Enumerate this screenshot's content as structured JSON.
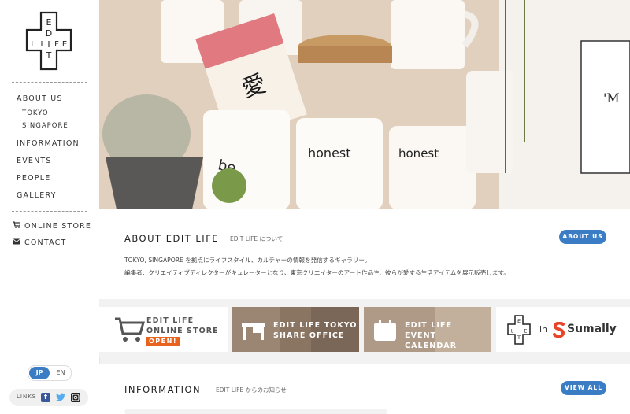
{
  "logo": {
    "letters": [
      "E",
      "D",
      "I",
      "T",
      "L",
      "I",
      "F",
      "E"
    ]
  },
  "nav": {
    "about": "ABOUT US",
    "tokyo": "TOKYO",
    "singapore": "SINGAPORE",
    "information": "INFORMATION",
    "events": "EVENTS",
    "people": "PEOPLE",
    "gallery": "GALLERY",
    "online_store": "ONLINE STORE",
    "contact": "CONTACT"
  },
  "lang": {
    "jp": "JP",
    "en": "EN"
  },
  "links": {
    "label": "LINKS"
  },
  "hero": {
    "partial_text": "'M"
  },
  "about": {
    "title": "ABOUT EDIT LIFE",
    "subtitle": "EDIT LIFE について",
    "button": "ABOUT US",
    "line1": "TOKYO, SINGAPORE を拠点にライフスタイル、カルチャーの情報を発信するギャラリー。",
    "line2": "編集者、クリエイティブディレクターがキュレーターとなり、東京クリエイターのアート作品や、彼らが愛する生活アイテムを展示販売します。"
  },
  "banners": {
    "store_line1": "EDIT LIFE",
    "store_line2": "ONLINE STORE",
    "store_badge": "OPEN!",
    "share_line1": "EDIT LIFE TOKYO",
    "share_line2": "SHARE OFFICE",
    "event_line1": "EDIT LIFE",
    "event_line2": "EVENT CALENDAR",
    "sumally_in": "in",
    "sumally_name": "Sumally"
  },
  "info": {
    "title": "INFORMATION",
    "subtitle": "EDIT LIFE からのお知らせ",
    "button": "VIEW ALL"
  }
}
